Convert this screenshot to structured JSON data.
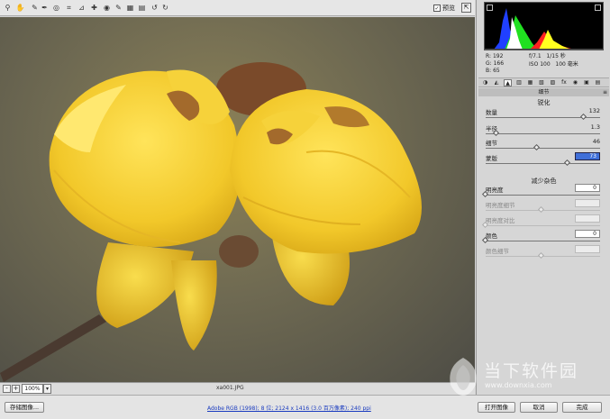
{
  "toolbar": {
    "tools": [
      "zoom-tool",
      "hand-tool",
      "white-balance-tool",
      "color-sampler-tool",
      "target-adjust-tool",
      "crop-tool",
      "straighten-tool",
      "spot-removal-tool",
      "red-eye-tool",
      "adjustment-brush-tool",
      "graduated-filter-tool",
      "preferences-tool",
      "rotate-ccw-tool",
      "rotate-cw-tool"
    ],
    "tool_glyphs": [
      "⚲",
      "✋",
      "✎",
      "✒",
      "◎",
      "⌗",
      "⊿",
      "✚",
      "◉",
      "✎",
      "▦",
      "▤",
      "↺",
      "↻"
    ],
    "preview_label": "预览",
    "preview_checked": true,
    "fullscreen_glyph": "⇱"
  },
  "image": {
    "zoom_value": "100%",
    "zoom_minus": "-",
    "zoom_plus": "+",
    "dropdown_glyph": "▾",
    "filename": "xa001.JPG"
  },
  "histogram": {
    "colors": {
      "red": "#ff2020",
      "green": "#20e020",
      "blue": "#2040ff",
      "yellow": "#ffff20",
      "white": "#ffffff"
    }
  },
  "readout": {
    "r_label": "R:",
    "r_value": "192",
    "g_label": "G:",
    "g_value": "166",
    "b_label": "B:",
    "b_value": "65",
    "aperture": "f/7.1",
    "shutter": "1/15 秒",
    "iso": "ISO 100",
    "focal": "100 毫米"
  },
  "tabs": {
    "items": [
      "◑",
      "◭",
      "▲",
      "▥",
      "▦",
      "▧",
      "▨",
      "fx",
      "◉",
      "▣",
      "▤"
    ],
    "active_index": 2
  },
  "panel": {
    "header": "细节",
    "menu_glyph": "≡",
    "sharpen": {
      "title": "锐化",
      "amount_label": "数量",
      "amount_value": "132",
      "amount_level": 0.88,
      "radius_label": "半径",
      "radius_value": "1.3",
      "radius_level": 0.1,
      "detail_label": "细节",
      "detail_value": "46",
      "detail_level": 0.46,
      "masking_label": "蒙版",
      "masking_value": "73",
      "masking_level": 0.73
    },
    "noise": {
      "title": "减少杂色",
      "luminance_label": "明亮度",
      "luminance_value": "0",
      "luminance_level": 0,
      "lum_detail_label": "明亮度细节",
      "lum_detail_value": "",
      "lum_detail_level": 0.5,
      "lum_contrast_label": "明亮度对比",
      "lum_contrast_value": "",
      "lum_contrast_level": 0,
      "color_label": "颜色",
      "color_value": "0",
      "color_level": 0,
      "color_detail_label": "颜色细节",
      "color_detail_value": "",
      "color_detail_level": 0.5
    }
  },
  "footer": {
    "save_label": "存储图像...",
    "workflow": "Adobe RGB (1998); 8 位; 2124 x 1416 (3.0 百万像素); 240 ppi",
    "open_label": "打开图像",
    "cancel_label": "取消",
    "done_label": "完成"
  },
  "watermark": {
    "title": "当下软件园",
    "url": "www.downxia.com"
  }
}
